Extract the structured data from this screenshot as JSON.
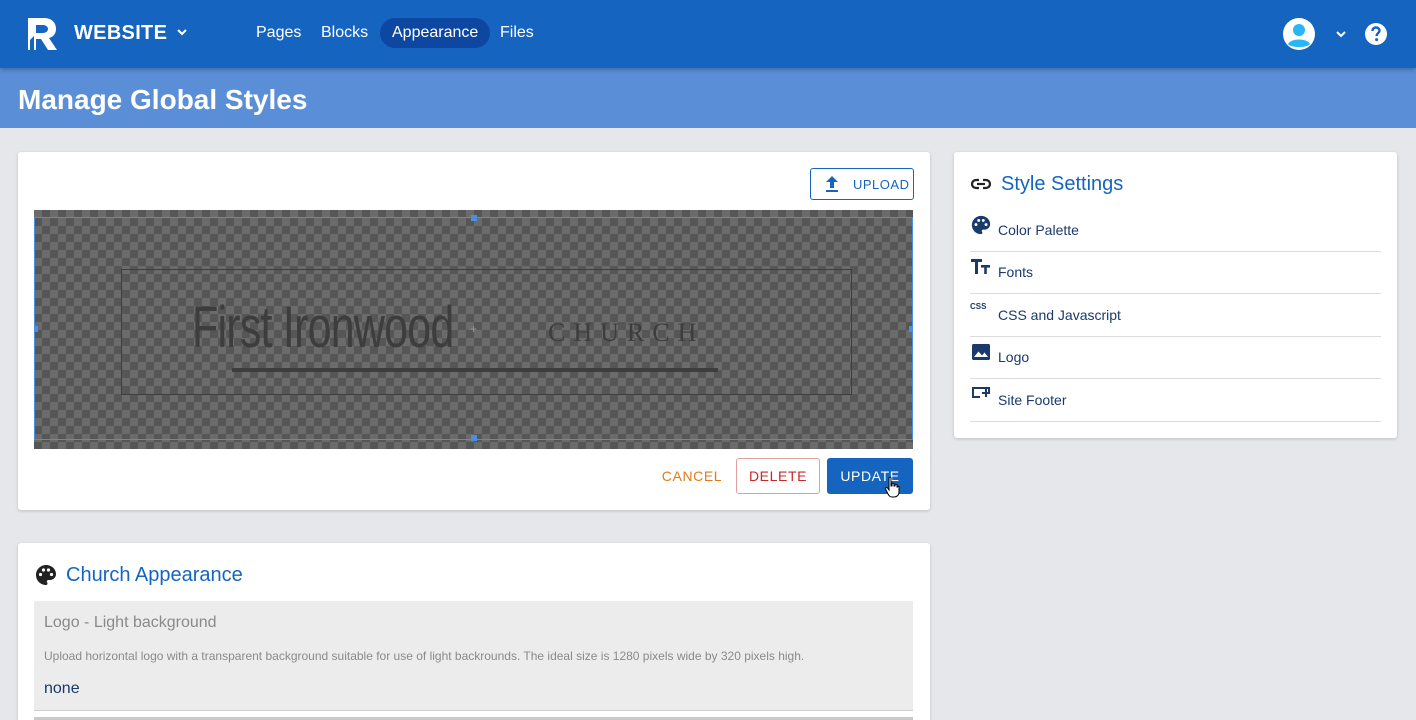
{
  "nav": {
    "site_name": "WEBSITE",
    "links": [
      {
        "label": "Pages"
      },
      {
        "label": "Blocks"
      },
      {
        "label": "Appearance"
      },
      {
        "label": "Files"
      }
    ]
  },
  "header": {
    "title": "Manage Global Styles"
  },
  "editor": {
    "upload_label": "UPLOAD",
    "logo_name": "First Ironwood",
    "logo_suffix": "CHURCH",
    "cancel_label": "CANCEL",
    "delete_label": "DELETE",
    "update_label": "UPDATE"
  },
  "appearance": {
    "title": "Church Appearance",
    "field_label": "Logo - Light background",
    "field_help": "Upload horizontal logo with a transparent background suitable for use of light backrounds. The ideal size is 1280 pixels wide by 320 pixels high.",
    "field_value": "none"
  },
  "settings": {
    "title": "Style Settings",
    "items": [
      {
        "label": "Color Palette",
        "icon": "palette-icon"
      },
      {
        "label": "Fonts",
        "icon": "text-fields-icon"
      },
      {
        "label": "CSS and Javascript",
        "icon": "css-icon"
      },
      {
        "label": "Logo",
        "icon": "image-icon"
      },
      {
        "label": "Site Footer",
        "icon": "footer-icon"
      }
    ]
  },
  "colors": {
    "primary": "#1565c0",
    "header_band": "#5a8fd8",
    "cancel": "#e07b1c",
    "delete": "#c62828"
  }
}
